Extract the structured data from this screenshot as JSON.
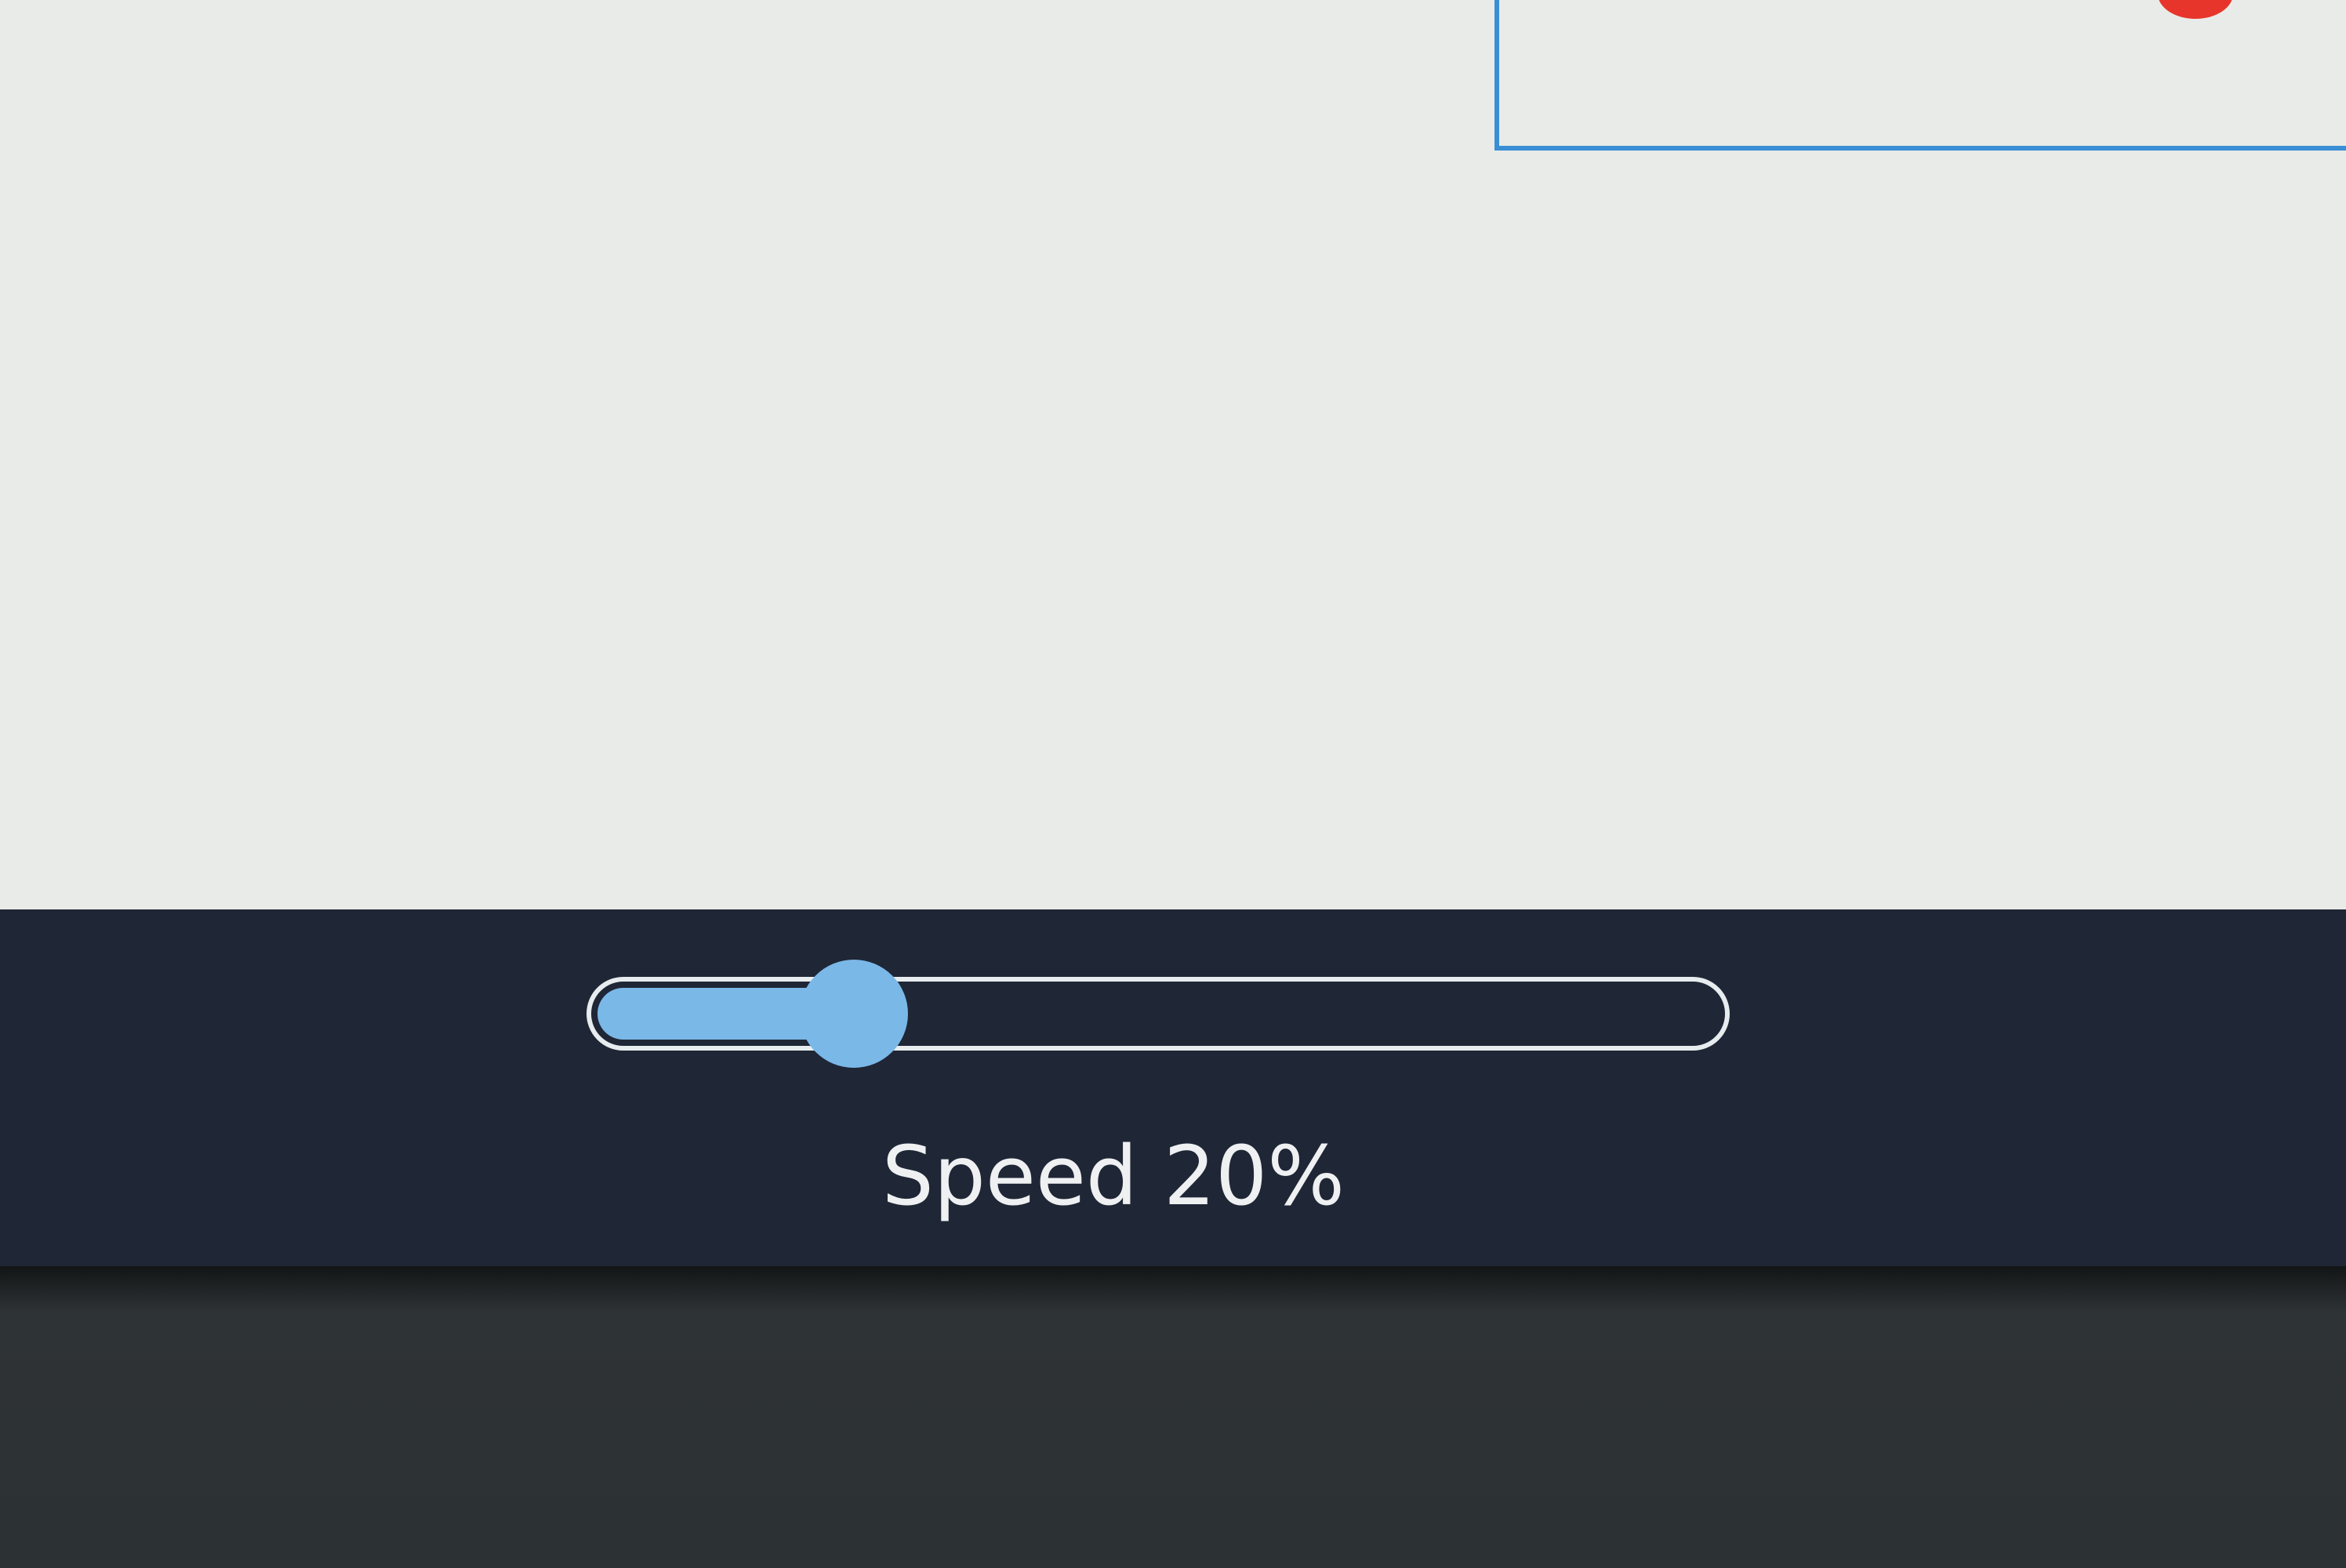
{
  "speed_control": {
    "label": "Speed 20%",
    "value_percent": 20
  },
  "colors": {
    "canvas_background": "#e9ebe8",
    "control_bar_background": "#1f2635",
    "slider_accent": "#7ab8e8",
    "slider_outline": "#e7ecef",
    "frame_blue": "#3a8ed6",
    "marker_red": "#e8352c"
  }
}
